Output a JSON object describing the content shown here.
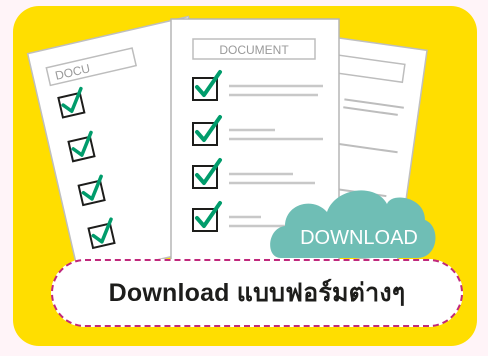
{
  "banner": {
    "doc_label_front": "DOCUMENT",
    "doc_label_back": "DOCU",
    "cloud_label": "DOWNLOAD",
    "button_label": "Download แบบฟอร์มต่างๆ"
  },
  "colors": {
    "background": "#ffde00",
    "check_mark": "#009c6b",
    "cloud": "#6fbeb5",
    "button_border": "#c0287c"
  },
  "icons": [
    "document-icon",
    "checkbox-icon",
    "cloud-download-icon"
  ]
}
